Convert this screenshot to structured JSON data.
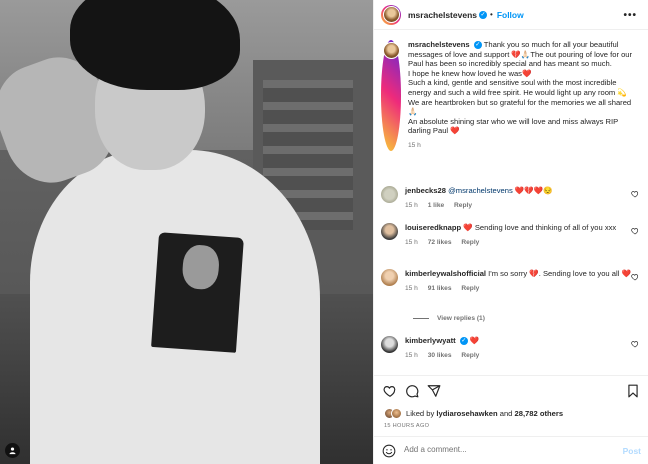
{
  "header": {
    "username": "msrachelstevens",
    "separator": "•",
    "follow_label": "Follow",
    "more_label": "•••"
  },
  "caption": {
    "username": "msrachelstevens",
    "text_1": "Thank you so much for all your beautiful messages of love and support 💔🙏🏻The out pouring of love for our Paul has been so incredibly special and has meant so much.",
    "text_2": "I hope he knew how loved he was❤️",
    "text_3": "Such a kind, gentle and sensitive soul with the most incredible energy and such a wild free spirit. He would light up any room 💫",
    "text_4": "We are heartbroken but so grateful for the memories we all shared 🙏🏻",
    "text_5": "An absolute shining star who we will love and miss always RIP darling Paul ❤️",
    "time": "15 h"
  },
  "comments": [
    {
      "username": "jenbecks28",
      "mention": "@msrachelstevens",
      "text": " ❤️💔❤️😔",
      "time": "15 h",
      "likes": "1 like",
      "reply": "Reply"
    },
    {
      "username": "louiseredknapp",
      "text": "❤️ Sending love and thinking of all of you xxx",
      "time": "15 h",
      "likes": "72 likes",
      "reply": "Reply"
    },
    {
      "username": "kimberleywalshofficial",
      "text": "I'm so sorry 💔. Sending love to you all ❤️",
      "time": "15 h",
      "likes": "91 likes",
      "reply": "Reply"
    },
    {
      "username": "kimberlywyatt",
      "text": "❤️",
      "time": "15 h",
      "likes": "30 likes",
      "reply": "Reply"
    }
  ],
  "view_replies": "View replies (1)",
  "likes": {
    "text_prefix": "Liked by ",
    "first_user": "lydiarosehawken",
    "conj": " and ",
    "count": "28,782 others"
  },
  "timestamp": "15 HOURS AGO",
  "add_comment": {
    "placeholder": "Add a comment...",
    "post_label": "Post"
  },
  "colors": {
    "accent": "#0095f6",
    "like_red": "#ed4956",
    "muted": "#737373"
  },
  "icons": [
    "heart-icon",
    "comment-icon",
    "share-icon",
    "bookmark-icon",
    "smile-icon",
    "user-tag-icon",
    "verified-icon",
    "more-icon"
  ]
}
